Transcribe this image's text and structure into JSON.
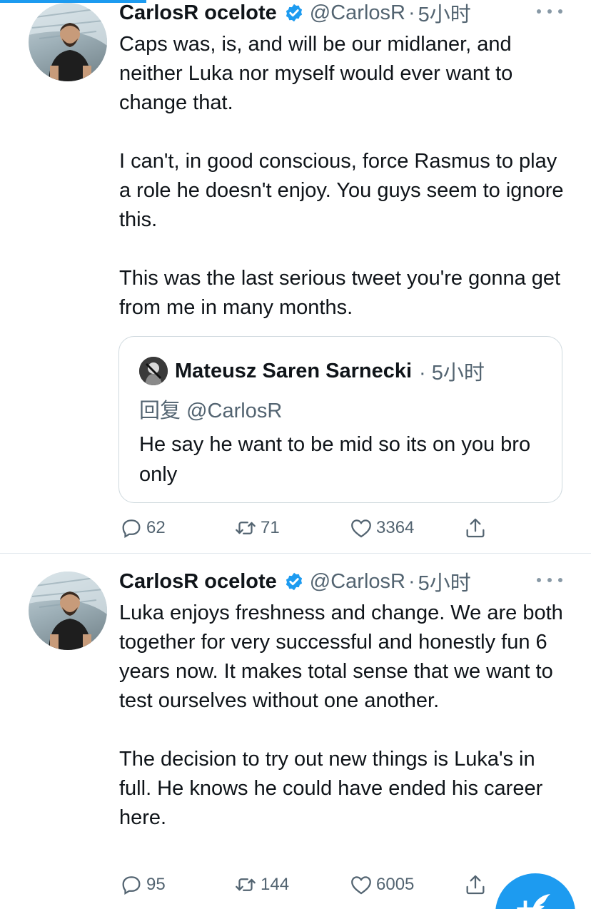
{
  "accent_color": "#1d9bf0",
  "tweets": [
    {
      "author_name": "CarlosR ocelote",
      "handle": "@CarlosR",
      "separator": "·",
      "time": "5小时",
      "verified": true,
      "paragraphs": [
        "Caps was, is, and will be our midlaner, and neither Luka nor myself would ever want to change that.",
        "I can't, in good conscious, force Rasmus to play a role he doesn't enjoy. You guys seem to ignore this.",
        "This was the last serious tweet you're gonna get from me in many months."
      ],
      "quote": {
        "author_name": "Mateusz Saren Sarnecki",
        "time": "· 5小时",
        "reply_prefix": "回复",
        "reply_handle": "@CarlosR",
        "text": "He say he want to be mid so its on you bro only"
      },
      "counts": {
        "replies": "62",
        "retweets": "71",
        "likes": "3364"
      }
    },
    {
      "author_name": "CarlosR ocelote",
      "handle": "@CarlosR",
      "separator": "·",
      "time": "5小时",
      "verified": true,
      "paragraphs": [
        "Luka enjoys freshness and change. We are both together for very successful and honestly fun 6 years now. It makes total sense that we want to test ourselves without one another.",
        "The decision to try out new things is Luka's in full. He knows he could have ended his career here."
      ],
      "counts": {
        "replies": "95",
        "retweets": "144",
        "likes": "6005"
      }
    }
  ],
  "icons": {
    "verified": "verified-badge-icon",
    "more": "more-dots-icon",
    "reply": "reply-bubble-icon",
    "retweet": "retweet-icon",
    "like": "heart-icon",
    "share": "share-upload-icon",
    "compose": "compose-feather-icon"
  }
}
